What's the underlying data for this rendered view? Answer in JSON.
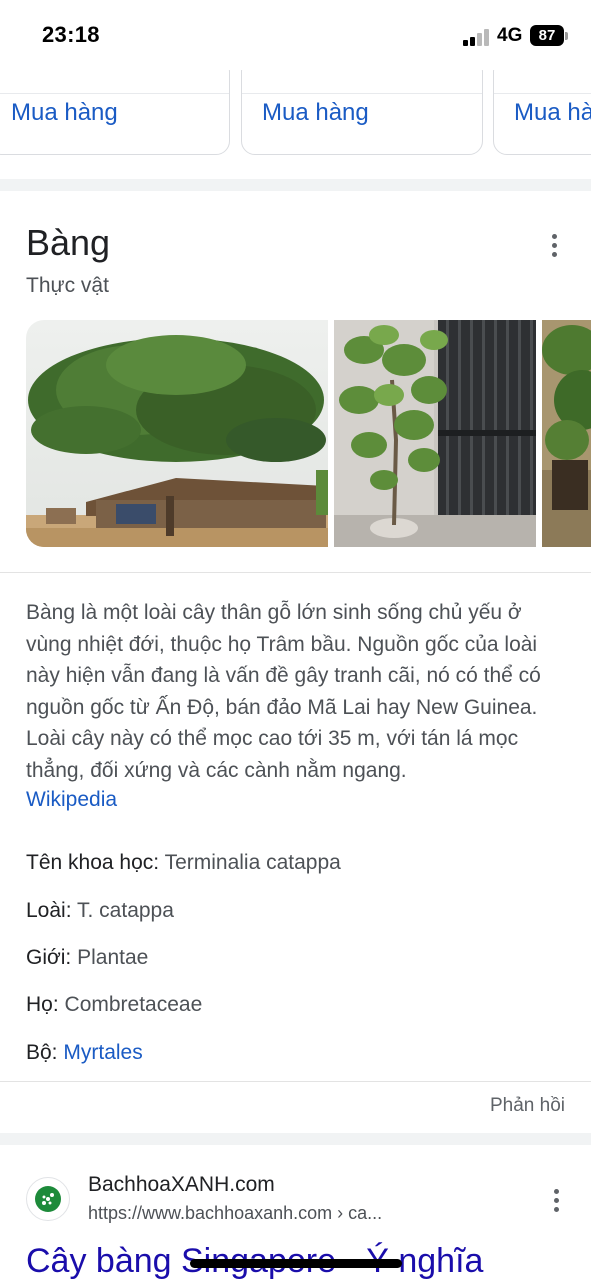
{
  "status_bar": {
    "time": "23:18",
    "network": "4G",
    "battery": "87"
  },
  "shopping": {
    "buy_label": "Mua hàng",
    "buy_label_partial": "Mua hà"
  },
  "knowledge_panel": {
    "title": "Bàng",
    "subtitle": "Thực vật",
    "images": [
      "tree-photo",
      "fiddle-leaf-fig-photo",
      "potted-plant-photo"
    ],
    "description": "Bàng là một loài cây thân gỗ lớn sinh sống chủ yếu ở vùng nhiệt đới, thuộc họ Trâm bầu. Nguồn gốc của loài này hiện vẫn đang là vấn đề gây tranh cãi, nó có thể có nguồn gốc từ Ấn Độ, bán đảo Mã Lai hay New Guinea. Loài cây này có thể mọc cao tới 35 m, với tán lá mọc thẳng, đối xứng và các cành nằm ngang.",
    "source_link": "Wikipedia",
    "facts": [
      {
        "label": "Tên khoa học:",
        "value": "Terminalia catappa"
      },
      {
        "label": "Loài:",
        "value": "T. catappa"
      },
      {
        "label": "Giới:",
        "value": "Plantae"
      },
      {
        "label": "Họ:",
        "value": "Combretaceae"
      },
      {
        "label": "Bộ:",
        "value": "Myrtales"
      }
    ],
    "feedback": "Phản hồi"
  },
  "result": {
    "site_name": "BachhoaXANH.com",
    "url": "https://www.bachhoaxanh.com › ca...",
    "title": "Cây bàng Singapore - Ý nghĩa"
  },
  "icons": [
    "more-vert-icon",
    "bachhoaxanh-favicon"
  ],
  "colors": {
    "link": "#1a5bc4",
    "title_link": "#1a0dab",
    "text": "#202124",
    "secondary": "#4d5156",
    "band": "#f1f3f4"
  }
}
